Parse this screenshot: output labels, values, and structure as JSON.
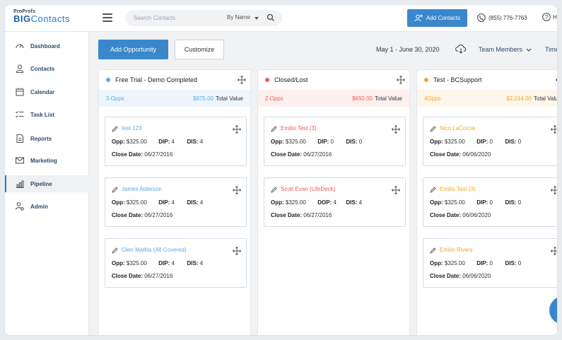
{
  "logo": {
    "small": "ProProfs",
    "big_bold": "BIG",
    "big_rest": "Contacts"
  },
  "search": {
    "placeholder": "Search Contacts",
    "filter_label": "By Name"
  },
  "header": {
    "add_contacts_label": "Add Contacts",
    "phone": "(855) 776-7763",
    "help_label": "H"
  },
  "sidebar": {
    "items": [
      {
        "label": "Dashboard",
        "icon": "gauge-icon"
      },
      {
        "label": "Contacts",
        "icon": "person-icon"
      },
      {
        "label": "Calendar",
        "icon": "calendar-icon"
      },
      {
        "label": "Task List",
        "icon": "checklist-icon"
      },
      {
        "label": "Reports",
        "icon": "document-icon"
      },
      {
        "label": "Marketing",
        "icon": "envelope-icon"
      },
      {
        "label": "Pipeline",
        "icon": "chart-icon",
        "active": true
      },
      {
        "label": "Admin",
        "icon": "users-gear-icon"
      }
    ]
  },
  "toolbar": {
    "add_opportunity": "Add Opportunity",
    "customize": "Customize",
    "date_range": "May 1 - June 30, 2020",
    "team_members": "Team Members",
    "timeline": "Time"
  },
  "colors": {
    "accent": "#3b87cc",
    "trial": "#5aa9e6",
    "closed": "#f05a5a",
    "test": "#f5a623"
  },
  "columns": [
    {
      "title": "Free Trial - Demo Completed",
      "opps": "3 Opps",
      "value": "$975.00",
      "total_label": "Total Value",
      "cards": [
        {
          "name": "test 123",
          "opp_label": "Opp:",
          "opp": "$325.00",
          "f2_label": "DIP:",
          "f2": "4",
          "f3_label": "DIS:",
          "f3": "4",
          "close_label": "Close Date:",
          "close": "06/27/2016"
        },
        {
          "name": "James Aiderson",
          "opp_label": "Opp:",
          "opp": "$325.00",
          "f2_label": "DIP:",
          "f2": "4",
          "f3_label": "DIS:",
          "f3": "4",
          "close_label": "Close Date:",
          "close": "06/27/2016"
        },
        {
          "name": "Glen Mathis (All Covered)",
          "opp_label": "Opp:",
          "opp": "$325.00",
          "f2_label": "DIP:",
          "f2": "4",
          "f3_label": "DIS:",
          "f3": "4",
          "close_label": "Close Date:",
          "close": "06/27/2016"
        }
      ]
    },
    {
      "title": "Closed/Lost",
      "opps": "2 Opps",
      "value": "$650.00",
      "total_label": "Total Value",
      "cards": [
        {
          "name": "Emilio Test (3)",
          "opp_label": "Opp:",
          "opp": "$325.00",
          "f2_label": "DIP:",
          "f2": "0",
          "f3_label": "DIS:",
          "f3": "0",
          "close_label": "Close Date:",
          "close": "06/27/2016"
        },
        {
          "name": "Scott Evan (LifeDeck)",
          "opp_label": "Opp:",
          "opp": "$325.00",
          "f2_label": "DOP:",
          "f2": "4",
          "f3_label": "DIS:",
          "f3": "4",
          "close_label": "Close Date:",
          "close": "06/27/2016"
        }
      ]
    },
    {
      "title": "Test - BCSupport",
      "opps": "4Opps",
      "value": "$2,014.00",
      "total_label": "Total Value",
      "cards": [
        {
          "name": "Nico LaCorcia",
          "opp_label": "Opp:",
          "opp": "$325.00",
          "f2_label": "DIP:",
          "f2": "0",
          "f3_label": "DIS:",
          "f3": "0",
          "close_label": "Close Date:",
          "close": "06/06/2020"
        },
        {
          "name": "Emilio Test (3)",
          "opp_label": "Opp:",
          "opp": "$325.00",
          "f2_label": "DIP:",
          "f2": "0",
          "f3_label": "DIS:",
          "f3": "0",
          "close_label": "Close Date:",
          "close": "06/06/2020"
        },
        {
          "name": "Emilio Rivers",
          "opp_label": "Opp:",
          "opp": "$325.00",
          "f2_label": "DIP:",
          "f2": "0",
          "f3_label": "DIS:",
          "f3": "0",
          "close_label": "Close Date:",
          "close": "06/06/2020"
        }
      ]
    }
  ]
}
